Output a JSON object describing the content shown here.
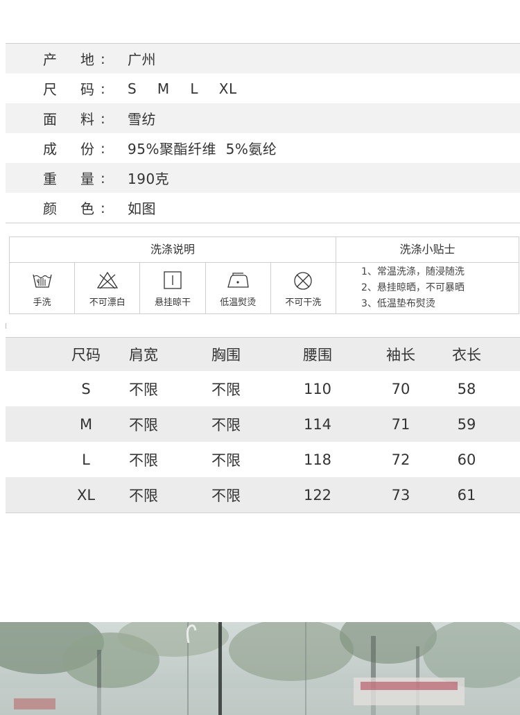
{
  "specs": [
    {
      "k1": "产",
      "k2": "地",
      "colon": ":",
      "value": "广州"
    },
    {
      "k1": "尺",
      "k2": "码",
      "colon": ":",
      "value": "S  M  L  XL"
    },
    {
      "k1": "面",
      "k2": "料",
      "colon": ":",
      "value": "雪纺"
    },
    {
      "k1": "成",
      "k2": "份",
      "colon": ":",
      "value": "95%聚酯纤维  5%氨纶"
    },
    {
      "k1": "重",
      "k2": "量",
      "colon": ":",
      "value": "190克"
    },
    {
      "k1": "颜",
      "k2": "色",
      "colon": ":",
      "value": "如图"
    }
  ],
  "care": {
    "header_left": "洗涤说明",
    "header_right": "洗涤小贴士",
    "icons": [
      {
        "icon": "hand-wash-icon",
        "label": "手洗"
      },
      {
        "icon": "no-bleach-icon",
        "label": "不可漂白"
      },
      {
        "icon": "hang-dry-icon",
        "label": "悬挂晾干"
      },
      {
        "icon": "low-iron-icon",
        "label": "低温熨烫"
      },
      {
        "icon": "no-dry-clean-icon",
        "label": "不可干洗"
      }
    ],
    "tips": [
      "1、常温洗涤，随浸随洗",
      "2、悬挂晾晒，不可暴晒",
      "3、低温垫布熨烫"
    ]
  },
  "size_table": {
    "headers": [
      "尺码",
      "肩宽",
      "胸围",
      "腰围",
      "袖长",
      "衣长"
    ],
    "rows": [
      [
        "S",
        "不限",
        "不限",
        "110",
        "70",
        "58"
      ],
      [
        "M",
        "不限",
        "不限",
        "114",
        "71",
        "59"
      ],
      [
        "L",
        "不限",
        "不限",
        "118",
        "72",
        "60"
      ],
      [
        "XL",
        "不限",
        "不限",
        "122",
        "73",
        "61"
      ]
    ]
  }
}
